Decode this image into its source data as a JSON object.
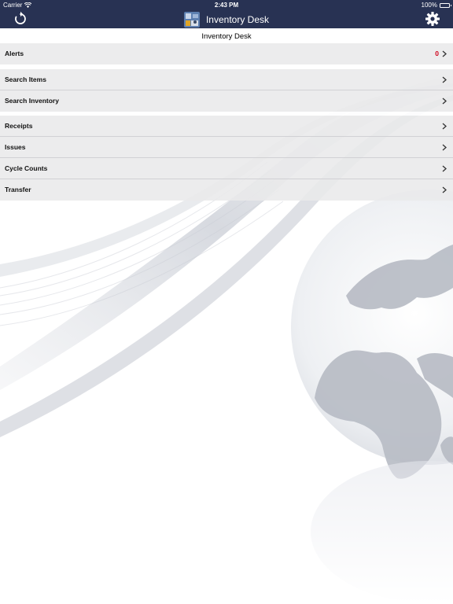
{
  "status_bar": {
    "carrier": "Carrier",
    "time": "2:43 PM",
    "battery": "100%",
    "wifi_icon": "wifi-icon",
    "battery_icon": "battery-icon"
  },
  "nav": {
    "title": "Inventory Desk",
    "left_icon": "refresh-icon",
    "right_icon": "gear-icon",
    "app_icon": "inventory-app-icon"
  },
  "subheader": "Inventory Desk",
  "groups": [
    {
      "items": [
        {
          "label": "Alerts",
          "badge": "0"
        }
      ]
    },
    {
      "items": [
        {
          "label": "Search Items"
        },
        {
          "label": "Search Inventory"
        }
      ]
    },
    {
      "items": [
        {
          "label": "Receipts"
        },
        {
          "label": "Issues"
        },
        {
          "label": "Cycle Counts"
        },
        {
          "label": "Transfer"
        }
      ]
    }
  ],
  "colors": {
    "nav_bg": "#283253",
    "row_bg": "#e9e9eb",
    "badge": "#d0021b"
  }
}
